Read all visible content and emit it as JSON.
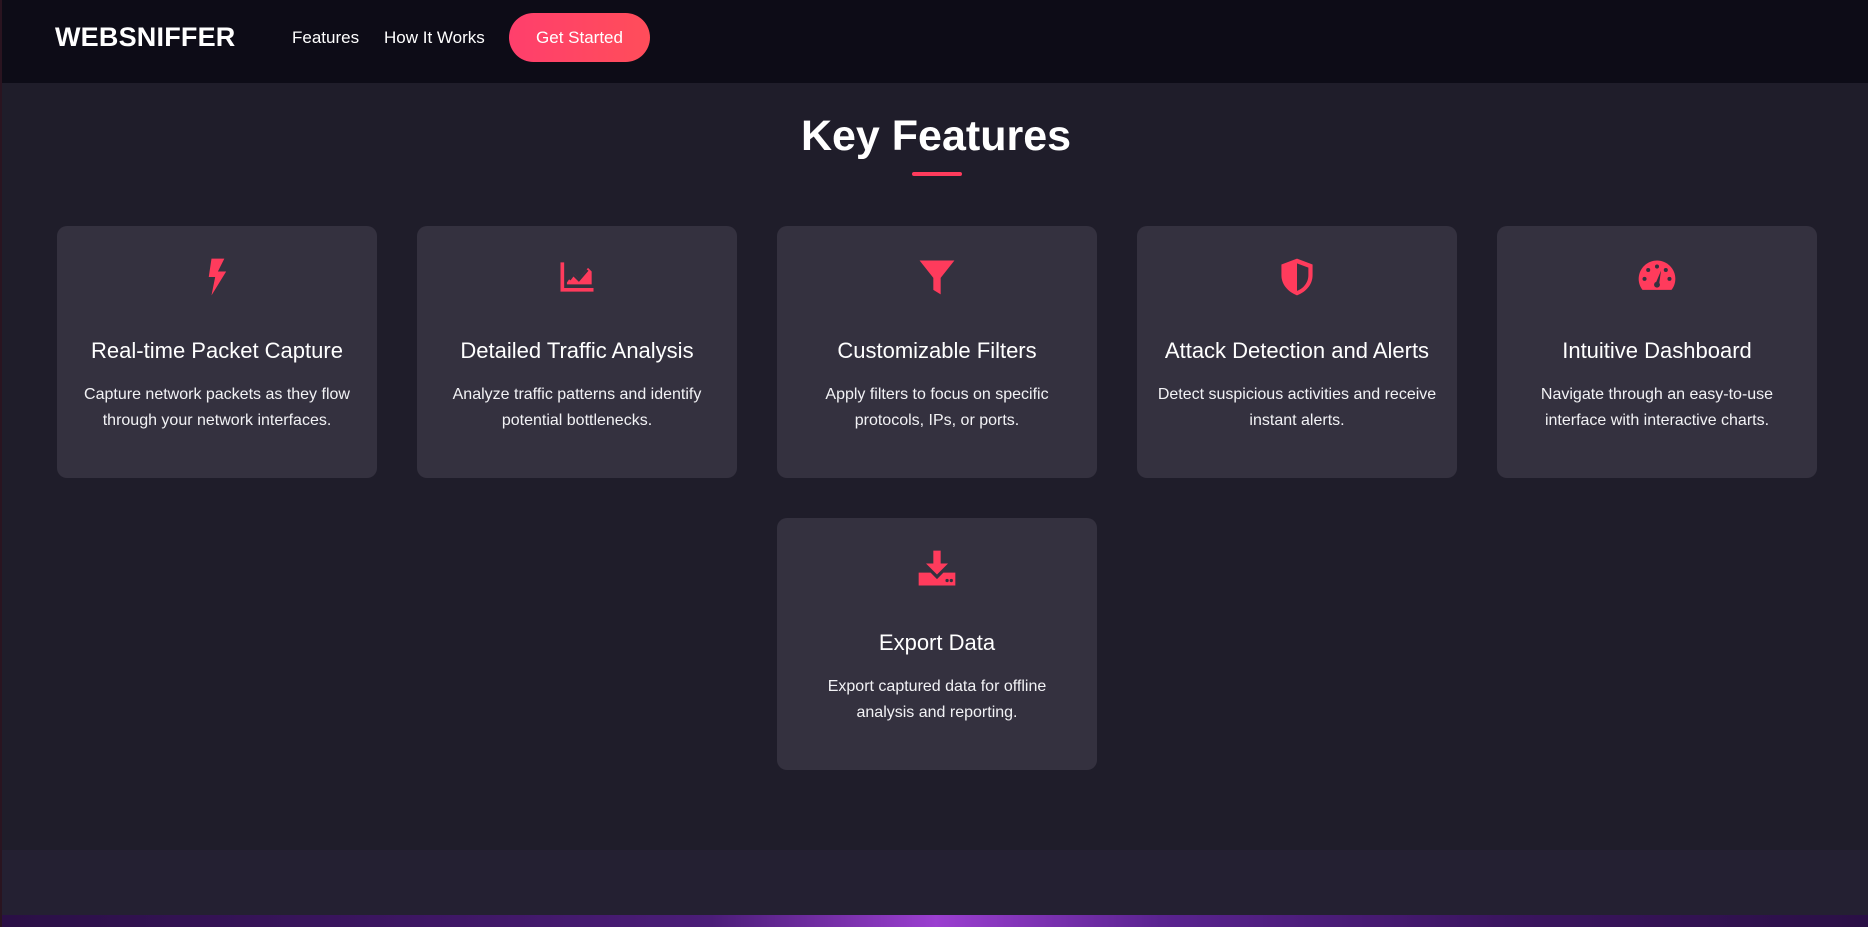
{
  "nav": {
    "brand": "WEBSNIFFER",
    "links": [
      "Features",
      "How It Works"
    ],
    "cta_label": "Get Started"
  },
  "features_section": {
    "title": "Key Features",
    "cards": [
      {
        "icon": "lightning-bolt-icon",
        "title": "Real-time Packet Capture",
        "description": "Capture network packets as they flow through your network interfaces."
      },
      {
        "icon": "area-chart-icon",
        "title": "Detailed Traffic Analysis",
        "description": "Analyze traffic patterns and identify potential bottlenecks."
      },
      {
        "icon": "filter-icon",
        "title": "Customizable Filters",
        "description": "Apply filters to focus on specific protocols, IPs, or ports."
      },
      {
        "icon": "shield-icon",
        "title": "Attack Detection and Alerts",
        "description": "Detect suspicious activities and receive instant alerts."
      },
      {
        "icon": "dashboard-gauge-icon",
        "title": "Intuitive Dashboard",
        "description": "Navigate through an easy-to-use interface with interactive charts."
      },
      {
        "icon": "download-icon",
        "title": "Export Data",
        "description": "Export captured data for offline analysis and reporting."
      }
    ]
  },
  "colors": {
    "accent": "#ff3b5c",
    "navbar_bg": "#0d0c17",
    "page_bg": "#1f1d2a",
    "card_bg": "#34313f"
  }
}
